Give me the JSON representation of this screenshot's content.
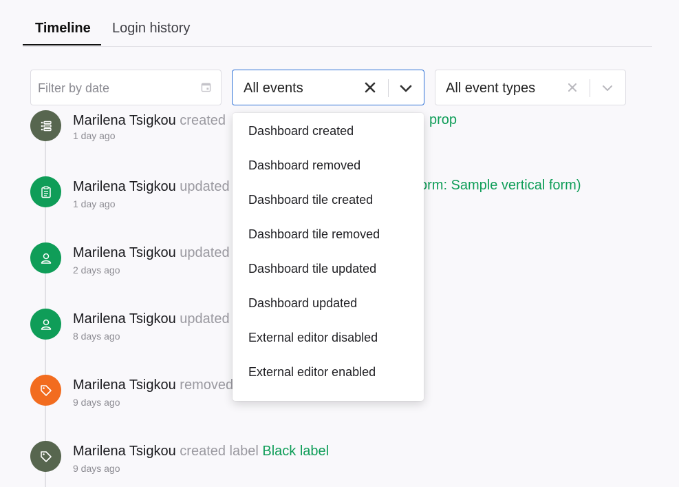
{
  "tabs": [
    {
      "label": "Timeline"
    },
    {
      "label": "Login history"
    }
  ],
  "filters": {
    "date_placeholder": "Filter by date",
    "events_value": "All events",
    "event_types_value": "All event types"
  },
  "events": [
    {
      "name": "Marilena Tsigkou",
      "action": "created",
      "target": "prop",
      "time": "1 day ago",
      "icon": "list-icon",
      "color": "#57664f"
    },
    {
      "name": "Marilena Tsigkou",
      "action": "updated",
      "target": "orm: Sample vertical form)",
      "time": "1 day ago",
      "icon": "clipboard-icon",
      "color": "#0f9d58"
    },
    {
      "name": "Marilena Tsigkou",
      "action": "updated",
      "target": "",
      "time": "2 days ago",
      "icon": "user-icon",
      "color": "#0f9d58"
    },
    {
      "name": "Marilena Tsigkou",
      "action": "updated",
      "target": "",
      "time": "8 days ago",
      "icon": "user-icon",
      "color": "#0f9d58"
    },
    {
      "name": "Marilena Tsigkou",
      "action": "removed",
      "target": "",
      "time": "9 days ago",
      "icon": "tag-icon",
      "color": "#f26c1f"
    },
    {
      "name": "Marilena Tsigkou",
      "action": "created label",
      "target": "Black label",
      "time": "9 days ago",
      "icon": "tag-icon",
      "color": "#57664f"
    }
  ],
  "dropdown": {
    "options": [
      "Dashboard created",
      "Dashboard removed",
      "Dashboard tile created",
      "Dashboard tile removed",
      "Dashboard tile updated",
      "Dashboard updated",
      "External editor disabled",
      "External editor enabled"
    ]
  }
}
